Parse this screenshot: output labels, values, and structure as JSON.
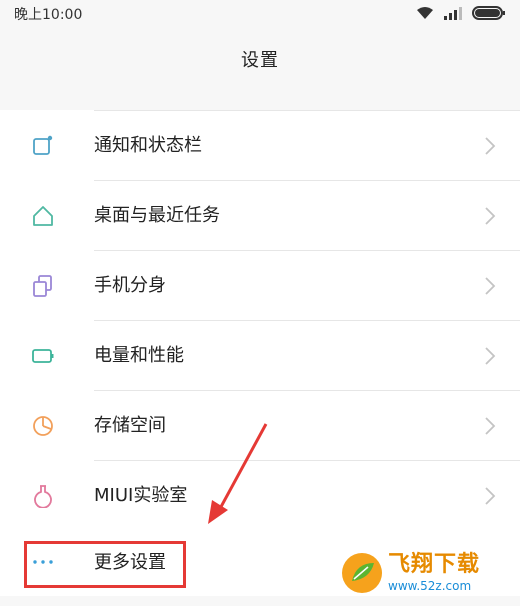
{
  "status_bar": {
    "time": "晚上10:00",
    "wifi_icon": "wifi-icon",
    "signal_icon": "signal-icon",
    "battery_icon": "battery-icon"
  },
  "header": {
    "title": "设置"
  },
  "menu": {
    "items": [
      {
        "label": "通知和状态栏",
        "icon": "notification-icon",
        "color": "#4fa3c7"
      },
      {
        "label": "桌面与最近任务",
        "icon": "home-icon",
        "color": "#4fb8a2"
      },
      {
        "label": "手机分身",
        "icon": "second-space-icon",
        "color": "#9a86d6"
      },
      {
        "label": "电量和性能",
        "icon": "battery-performance-icon",
        "color": "#3cb49a"
      },
      {
        "label": "存储空间",
        "icon": "storage-icon",
        "color": "#f2a05b"
      },
      {
        "label": "MIUI实验室",
        "icon": "lab-flask-icon",
        "color": "#e2799c"
      }
    ],
    "more": {
      "label": "更多设置",
      "icon": "more-dots-icon",
      "color": "#3a9fd8"
    }
  },
  "annotation": {
    "highlight_color": "#e53935"
  },
  "watermark": {
    "title": "飞翔下载",
    "url": "www.52z.com"
  }
}
